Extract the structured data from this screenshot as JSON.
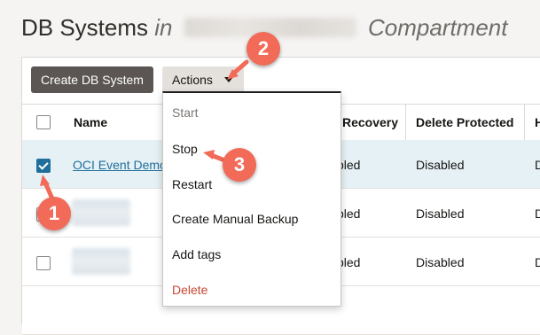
{
  "page": {
    "title_main": "DB Systems",
    "title_in": "in",
    "title_compartment": "Compartment"
  },
  "toolbar": {
    "create_label": "Create DB System",
    "actions_label": "Actions"
  },
  "table": {
    "headers": [
      "Name",
      "Recovery",
      "Delete Protected",
      "H"
    ],
    "rows": [
      {
        "name": "OCI Event Demo",
        "selected": true,
        "recovery": "bled",
        "delete_protected": "Disabled",
        "last": "D"
      },
      {
        "name": "",
        "selected": false,
        "recovery": "bled",
        "delete_protected": "Disabled",
        "last": "D"
      },
      {
        "name": "",
        "selected": false,
        "recovery": "bled",
        "delete_protected": "Disabled",
        "last": "D"
      }
    ]
  },
  "actions_menu": {
    "items": [
      "Start",
      "Stop",
      "Restart",
      "Create Manual Backup",
      "Add tags",
      "Delete"
    ]
  },
  "callouts": [
    "1",
    "2",
    "3"
  ],
  "colors": {
    "accent": "#1f6f9a",
    "callout": "#f26a58",
    "danger": "#c74634",
    "primary_button": "#5b5653"
  }
}
